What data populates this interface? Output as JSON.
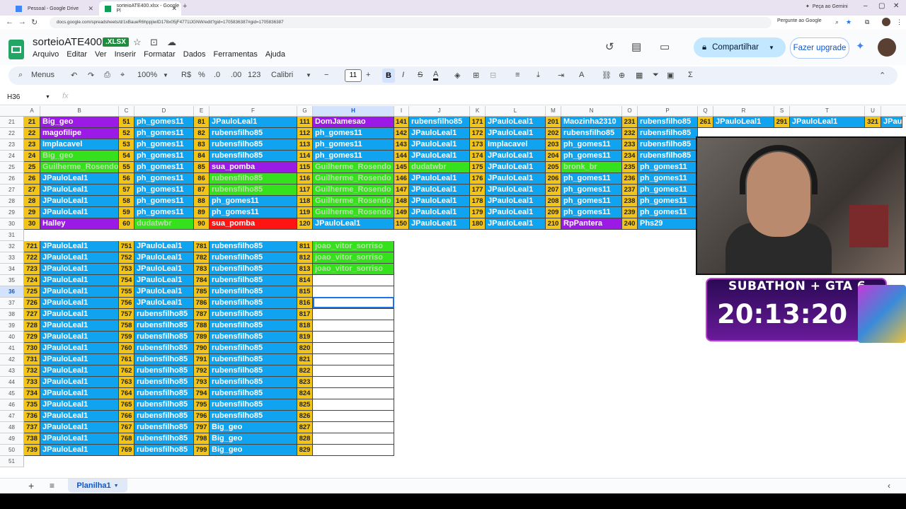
{
  "browser": {
    "tabs": [
      {
        "label": "Pessoal - Google Drive",
        "color": "#4285f4"
      },
      {
        "label": "sorteioATE400.xlsx - Google Pl",
        "color": "#0f9d58"
      }
    ],
    "new_tab": "+",
    "gemini_button": "Peça ao Gemini",
    "url": "docs.google.com/spreadsheets/d/1xBaueR6hppjiwID178x05jF4771lJGNW/edit?gid=1705836387#gid=1705836387",
    "ask_google": "Pergunte ao Google"
  },
  "doc": {
    "title": "sorteioATE400",
    "badge": ".XLSX",
    "menus": [
      "Arquivo",
      "Editar",
      "Ver",
      "Inserir",
      "Formatar",
      "Dados",
      "Ferramentas",
      "Ajuda"
    ],
    "share_label": "Compartilhar",
    "upgrade_label": "Fazer upgrade"
  },
  "toolbar": {
    "menus_label": "Menus",
    "zoom": "100%",
    "currency": "R$",
    "percent": "%",
    "dec_less": ".0",
    "dec_more": ".00",
    "format_123": "123",
    "font": "Calibri",
    "font_size": "11",
    "bold": "B",
    "italic": "I",
    "strike": "S",
    "text_color": "A"
  },
  "formula": {
    "cell_ref": "H36",
    "fx": "fx"
  },
  "columns": [
    {
      "l": "A",
      "sel": false
    },
    {
      "l": "B",
      "sel": false
    },
    {
      "l": "C",
      "sel": false
    },
    {
      "l": "D",
      "sel": false
    },
    {
      "l": "E",
      "sel": false
    },
    {
      "l": "F",
      "sel": false
    },
    {
      "l": "G",
      "sel": false
    },
    {
      "l": "H",
      "sel": true
    },
    {
      "l": "I",
      "sel": false
    },
    {
      "l": "J",
      "sel": false
    },
    {
      "l": "K",
      "sel": false
    },
    {
      "l": "L",
      "sel": false
    },
    {
      "l": "M",
      "sel": false
    },
    {
      "l": "N",
      "sel": false
    },
    {
      "l": "O",
      "sel": false
    },
    {
      "l": "P",
      "sel": false
    },
    {
      "l": "Q",
      "sel": false
    },
    {
      "l": "R",
      "sel": false
    },
    {
      "l": "S",
      "sel": false
    },
    {
      "l": "T",
      "sel": false
    },
    {
      "l": "U",
      "sel": false
    }
  ],
  "rows": [
    "21",
    "22",
    "23",
    "24",
    "25",
    "26",
    "27",
    "28",
    "29",
    "30",
    "31",
    "32",
    "33",
    "34",
    "35",
    "36",
    "37",
    "38",
    "39",
    "40",
    "41",
    "42",
    "43",
    "44",
    "45",
    "46",
    "47",
    "48",
    "49",
    "50",
    "51"
  ],
  "selected_row": "36",
  "top_block": [
    [
      [
        "21",
        "Big_geo",
        "p"
      ],
      [
        "51",
        "ph_gomes11",
        "b"
      ],
      [
        "81",
        "JPauloLeal1",
        "b"
      ],
      [
        "111",
        "DomJamesao",
        "p"
      ],
      [
        "141",
        "rubensfilho85",
        "b"
      ],
      [
        "171",
        "JPauloLeal1",
        "b"
      ],
      [
        "201",
        "Maozinha2310",
        "b"
      ],
      [
        "231",
        "rubensfilho85",
        "b"
      ],
      [
        "261",
        "JPauloLeal1",
        "b"
      ],
      [
        "291",
        "JPauloLeal1",
        "b"
      ],
      [
        "321",
        "JPau",
        "b"
      ]
    ],
    [
      [
        "22",
        "magofilipe",
        "p"
      ],
      [
        "52",
        "ph_gomes11",
        "b"
      ],
      [
        "82",
        "rubensfilho85",
        "b"
      ],
      [
        "112",
        "ph_gomes11",
        "b"
      ],
      [
        "142",
        "JPauloLeal1",
        "b"
      ],
      [
        "172",
        "JPauloLeal1",
        "b"
      ],
      [
        "202",
        "rubensfilho85",
        "b"
      ],
      [
        "232",
        "rubensfilho85",
        "b"
      ]
    ],
    [
      [
        "23",
        "Implacavel",
        "b"
      ],
      [
        "53",
        "ph_gomes11",
        "b"
      ],
      [
        "83",
        "rubensfilho85",
        "b"
      ],
      [
        "113",
        "ph_gomes11",
        "b"
      ],
      [
        "143",
        "JPauloLeal1",
        "b"
      ],
      [
        "173",
        "Implacavel",
        "b"
      ],
      [
        "203",
        "ph_gomes11",
        "b"
      ],
      [
        "233",
        "rubensfilho85",
        "b"
      ]
    ],
    [
      [
        "24",
        "Big_geo",
        "g"
      ],
      [
        "54",
        "ph_gomes11",
        "b"
      ],
      [
        "84",
        "rubensfilho85",
        "b"
      ],
      [
        "114",
        "ph_gomes11",
        "b"
      ],
      [
        "144",
        "JPauloLeal1",
        "b"
      ],
      [
        "174",
        "JPauloLeal1",
        "b"
      ],
      [
        "204",
        "ph_gomes11",
        "b"
      ],
      [
        "234",
        "rubensfilho85",
        "b"
      ]
    ],
    [
      [
        "25",
        "Guilherme_Rosendo",
        "g"
      ],
      [
        "55",
        "ph_gomes11",
        "b"
      ],
      [
        "85",
        "sua_pomba",
        "p"
      ],
      [
        "115",
        "Guilherme_Rosendo",
        "g"
      ],
      [
        "145",
        "dudatwbr",
        "g"
      ],
      [
        "175",
        "JPauloLeal1",
        "b"
      ],
      [
        "205",
        "bronk_br",
        "g"
      ],
      [
        "235",
        "ph_gomes11",
        "b"
      ]
    ],
    [
      [
        "26",
        "JPauloLeal1",
        "b"
      ],
      [
        "56",
        "ph_gomes11",
        "b"
      ],
      [
        "86",
        "rubensfilho85",
        "g"
      ],
      [
        "116",
        "Guilherme_Rosendo",
        "g"
      ],
      [
        "146",
        "JPauloLeal1",
        "b"
      ],
      [
        "176",
        "JPauloLeal1",
        "b"
      ],
      [
        "206",
        "ph_gomes11",
        "b"
      ],
      [
        "236",
        "ph_gomes11",
        "b"
      ]
    ],
    [
      [
        "27",
        "JPauloLeal1",
        "b"
      ],
      [
        "57",
        "ph_gomes11",
        "b"
      ],
      [
        "87",
        "rubensfilho85",
        "g"
      ],
      [
        "117",
        "Guilherme_Rosendo",
        "g"
      ],
      [
        "147",
        "JPauloLeal1",
        "b"
      ],
      [
        "177",
        "JPauloLeal1",
        "b"
      ],
      [
        "207",
        "ph_gomes11",
        "b"
      ],
      [
        "237",
        "ph_gomes11",
        "b"
      ]
    ],
    [
      [
        "28",
        "JPauloLeal1",
        "b"
      ],
      [
        "58",
        "ph_gomes11",
        "b"
      ],
      [
        "88",
        "ph_gomes11",
        "b"
      ],
      [
        "118",
        "Guilherme_Rosendo",
        "g"
      ],
      [
        "148",
        "JPauloLeal1",
        "b"
      ],
      [
        "178",
        "JPauloLeal1",
        "b"
      ],
      [
        "208",
        "ph_gomes11",
        "b"
      ],
      [
        "238",
        "ph_gomes11",
        "b"
      ]
    ],
    [
      [
        "29",
        "JPauloLeal1",
        "b"
      ],
      [
        "59",
        "ph_gomes11",
        "b"
      ],
      [
        "89",
        "ph_gomes11",
        "b"
      ],
      [
        "119",
        "Guilherme_Rosendo",
        "g"
      ],
      [
        "149",
        "JPauloLeal1",
        "b"
      ],
      [
        "179",
        "JPauloLeal1",
        "b"
      ],
      [
        "209",
        "ph_gomes11",
        "b"
      ],
      [
        "239",
        "ph_gomes11",
        "b"
      ]
    ],
    [
      [
        "30",
        "Halley",
        "p"
      ],
      [
        "60",
        "dudatwbr",
        "g"
      ],
      [
        "90",
        "sua_pomba",
        "r"
      ],
      [
        "120",
        "JPauloLeal1",
        "b"
      ],
      [
        "150",
        "JPauloLeal1",
        "b"
      ],
      [
        "180",
        "JPauloLeal1",
        "b"
      ],
      [
        "210",
        "RpPantera",
        "p"
      ],
      [
        "240",
        "Phs29",
        "b"
      ]
    ]
  ],
  "bottom_block": [
    [
      [
        "721",
        "JPauloLeal1",
        "b"
      ],
      [
        "751",
        "JPauloLeal1",
        "b"
      ],
      [
        "781",
        "rubensfilho85",
        "b"
      ],
      [
        "811",
        "joao_vitor_sorriso",
        "g"
      ]
    ],
    [
      [
        "722",
        "JPauloLeal1",
        "b"
      ],
      [
        "752",
        "JPauloLeal1",
        "b"
      ],
      [
        "782",
        "rubensfilho85",
        "b"
      ],
      [
        "812",
        "joao_vitor_sorriso",
        "g"
      ]
    ],
    [
      [
        "723",
        "JPauloLeal1",
        "b"
      ],
      [
        "753",
        "JPauloLeal1",
        "b"
      ],
      [
        "783",
        "rubensfilho85",
        "b"
      ],
      [
        "813",
        "joao_vitor_sorriso",
        "g"
      ]
    ],
    [
      [
        "724",
        "JPauloLeal1",
        "b"
      ],
      [
        "754",
        "JPauloLeal1",
        "b"
      ],
      [
        "784",
        "rubensfilho85",
        "b"
      ],
      [
        "814",
        "",
        "w"
      ]
    ],
    [
      [
        "725",
        "JPauloLeal1",
        "b"
      ],
      [
        "755",
        "JPauloLeal1",
        "b"
      ],
      [
        "785",
        "rubensfilho85",
        "b"
      ],
      [
        "815",
        "",
        "w"
      ]
    ],
    [
      [
        "726",
        "JPauloLeal1",
        "b"
      ],
      [
        "756",
        "JPauloLeal1",
        "b"
      ],
      [
        "786",
        "rubensfilho85",
        "b"
      ],
      [
        "816",
        "",
        "w"
      ]
    ],
    [
      [
        "727",
        "JPauloLeal1",
        "b"
      ],
      [
        "757",
        "rubensfilho85",
        "b"
      ],
      [
        "787",
        "rubensfilho85",
        "b"
      ],
      [
        "817",
        "",
        "w"
      ]
    ],
    [
      [
        "728",
        "JPauloLeal1",
        "b"
      ],
      [
        "758",
        "rubensfilho85",
        "b"
      ],
      [
        "788",
        "rubensfilho85",
        "b"
      ],
      [
        "818",
        "",
        "w"
      ]
    ],
    [
      [
        "729",
        "JPauloLeal1",
        "b"
      ],
      [
        "759",
        "rubensfilho85",
        "b"
      ],
      [
        "789",
        "rubensfilho85",
        "b"
      ],
      [
        "819",
        "",
        "w"
      ]
    ],
    [
      [
        "730",
        "JPauloLeal1",
        "b"
      ],
      [
        "760",
        "rubensfilho85",
        "b"
      ],
      [
        "790",
        "rubensfilho85",
        "b"
      ],
      [
        "820",
        "",
        "w"
      ]
    ],
    [
      [
        "731",
        "JPauloLeal1",
        "b"
      ],
      [
        "761",
        "rubensfilho85",
        "b"
      ],
      [
        "791",
        "rubensfilho85",
        "b"
      ],
      [
        "821",
        "",
        "w"
      ]
    ],
    [
      [
        "732",
        "JPauloLeal1",
        "b"
      ],
      [
        "762",
        "rubensfilho85",
        "b"
      ],
      [
        "792",
        "rubensfilho85",
        "b"
      ],
      [
        "822",
        "",
        "w"
      ]
    ],
    [
      [
        "733",
        "JPauloLeal1",
        "b"
      ],
      [
        "763",
        "rubensfilho85",
        "b"
      ],
      [
        "793",
        "rubensfilho85",
        "b"
      ],
      [
        "823",
        "",
        "w"
      ]
    ],
    [
      [
        "734",
        "JPauloLeal1",
        "b"
      ],
      [
        "764",
        "rubensfilho85",
        "b"
      ],
      [
        "794",
        "rubensfilho85",
        "b"
      ],
      [
        "824",
        "",
        "w"
      ]
    ],
    [
      [
        "735",
        "JPauloLeal1",
        "b"
      ],
      [
        "765",
        "rubensfilho85",
        "b"
      ],
      [
        "795",
        "rubensfilho85",
        "b"
      ],
      [
        "825",
        "",
        "w"
      ]
    ],
    [
      [
        "736",
        "JPauloLeal1",
        "b"
      ],
      [
        "766",
        "rubensfilho85",
        "b"
      ],
      [
        "796",
        "rubensfilho85",
        "b"
      ],
      [
        "826",
        "",
        "w"
      ]
    ],
    [
      [
        "737",
        "JPauloLeal1",
        "b"
      ],
      [
        "767",
        "rubensfilho85",
        "b"
      ],
      [
        "797",
        "Big_geo",
        "b"
      ],
      [
        "827",
        "",
        "w"
      ]
    ],
    [
      [
        "738",
        "JPauloLeal1",
        "b"
      ],
      [
        "768",
        "rubensfilho85",
        "b"
      ],
      [
        "798",
        "Big_geo",
        "b"
      ],
      [
        "828",
        "",
        "w"
      ]
    ],
    [
      [
        "739",
        "JPauloLeal1",
        "b"
      ],
      [
        "769",
        "rubensfilho85",
        "b"
      ],
      [
        "799",
        "Big_geo",
        "b"
      ],
      [
        "829",
        "",
        "w"
      ]
    ]
  ],
  "fill_colors": {
    "b": "#10a4f0",
    "p": "#9b1ae6",
    "g": "#35e01c",
    "r": "#ff1414",
    "w": "#ffffff",
    "num": "#f2c417"
  },
  "sheet": {
    "name": "Planilha1"
  },
  "overlay": {
    "subathon_title": "SUBATHON + GTA 6",
    "timer": "20:13:20"
  }
}
